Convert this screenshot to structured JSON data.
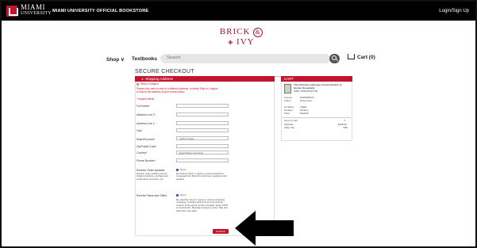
{
  "topbar": {
    "logo_main": "MIAMI",
    "logo_sub": "UNIVERSITY",
    "store_name": "MIAMI UNIVERSITY OFFICIAL BOOKSTORE",
    "login": "Login/Sign Up"
  },
  "brand": {
    "word1": "BRICK",
    "amp": "&",
    "word2": "IVY"
  },
  "nav": {
    "shop": "Shop ∨",
    "textbooks": "Textbooks",
    "search_placeholder": "Search",
    "cart": "Cart (0)"
  },
  "checkout": {
    "title": "SECURE CHECKOUT",
    "shipping_header": "1. Shipping Address",
    "ship_to_campus": "Ship to Campus",
    "note": "Please click here to ship to a different address, or select Ship to Campus",
    "note2": "to ship to the address of your choice below.",
    "required": "* required fields",
    "fields": [
      {
        "label": "Full Name*",
        "value": ""
      },
      {
        "label": "Address Line 1*",
        "value": ""
      },
      {
        "label": "Address Line 2",
        "value": ""
      },
      {
        "label": "City*",
        "value": ""
      },
      {
        "label": "State/Province*",
        "value": "- Select a State -"
      },
      {
        "label": "Zip/Postal Code*",
        "value": ""
      },
      {
        "label": "Country*",
        "value": "United States of America"
      },
      {
        "label": "Phone Number*",
        "value": ""
      }
    ],
    "receive_order": "Receive Order Updates",
    "receive_order_sub": "Receive order updates such as shipping tracking, purchase/prior, rental return reminders, etc.",
    "order_opt": "Opt-in",
    "order_fine": "By clicking \"Opt-In\" I agree to receive text/phone messages from Brick & Ivy/Campus regarding order updates.",
    "receive_news": "Receive News and Offers",
    "news_opt": "Opt-in",
    "news_fine": "By selecting \"Opt-In\" I agree to receive marketing messages, including discounts and promotional content, at the phone number provided. Reply STOP to unsubscribe. Message frequency varies. Msg and data rates may apply.",
    "continue": "Continue"
  },
  "cart": {
    "header": "CART",
    "item_title": "The Cultural Landscape An Introduction to Human Geography",
    "item_isbn": "ISBN: 9780135116739",
    "item_details": [
      {
        "k": "Format",
        "v": "PAPERBACK"
      },
      {
        "k": "Author",
        "v": "Rubenstein"
      },
      {
        "k": "Condition",
        "v": "USED"
      },
      {
        "k": "Duration",
        "v": "Till End"
      },
      {
        "k": "Price",
        "v": "$108.99"
      }
    ],
    "items_label": "Items in Cart",
    "items_value": "1",
    "subtotal_label": "Subtotal",
    "subtotal_value": "$108.99",
    "tax_label": "Sales Tax",
    "tax_value": "TBD"
  },
  "colors": {
    "accent": "#c3142d",
    "topbar": "#000000"
  }
}
